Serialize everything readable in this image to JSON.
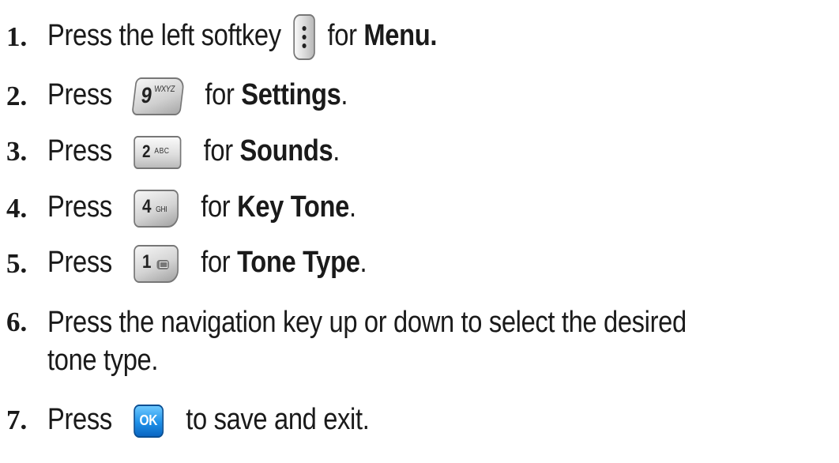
{
  "steps": [
    {
      "num": "1.",
      "before": "Press the left softkey",
      "key_icon": "left-softkey-icon",
      "after": "for",
      "bold": "Menu.",
      "end": ""
    },
    {
      "num": "2.",
      "before": "Press",
      "key_icon": "key-9-wxyz-icon",
      "key_big": "9",
      "key_small": "WXYZ",
      "after": "for",
      "bold": "Settings",
      "end": "."
    },
    {
      "num": "3.",
      "before": "Press",
      "key_icon": "key-2-abc-icon",
      "key_big": "2",
      "key_small": "ABC",
      "after": "for",
      "bold": "Sounds",
      "end": "."
    },
    {
      "num": "4.",
      "before": "Press",
      "key_icon": "key-4-ghi-icon",
      "key_big": "4",
      "key_small": "GHI",
      "after": "for",
      "bold": "Key Tone",
      "end": "."
    },
    {
      "num": "5.",
      "before": "Press",
      "key_icon": "key-1-mail-icon",
      "key_big": "1",
      "after": "for",
      "bold": "Tone Type",
      "end": "."
    },
    {
      "num": "6.",
      "line1": "Press the navigation key up or down to select the desired",
      "line2": "tone type."
    },
    {
      "num": "7.",
      "before": "Press",
      "key_icon": "ok-key-icon",
      "key_label": "OK",
      "after": "to save and exit."
    }
  ]
}
